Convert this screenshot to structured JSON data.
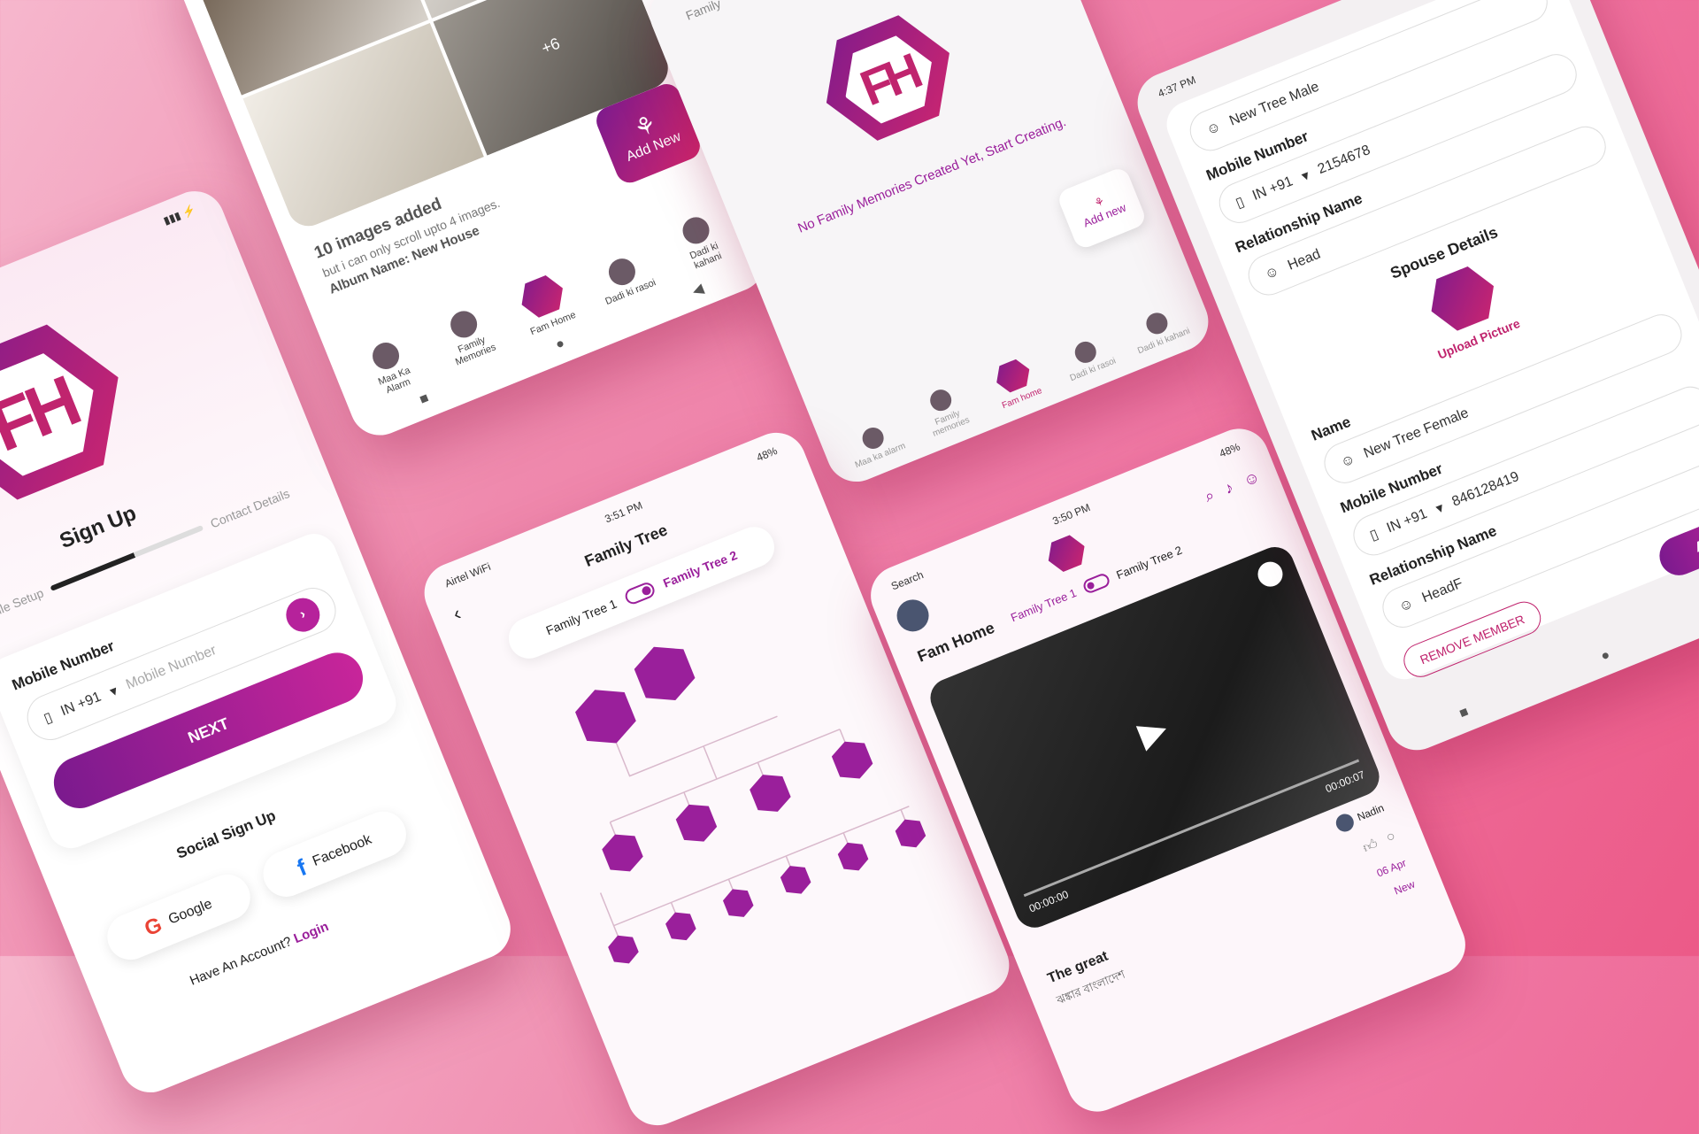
{
  "signup": {
    "title": "Sign Up",
    "steps": [
      "Profile Setup",
      "Contact Details"
    ],
    "mobile_label": "Mobile Number",
    "country_code": "IN +91",
    "mobile_placeholder": "Mobile Number",
    "next_label": "NEXT",
    "social_title": "Social Sign Up",
    "facebook_label": "Facebook",
    "google_label": "Google",
    "have_account": "Have An Account?",
    "login_label": "Login"
  },
  "album": {
    "more_count": "+6",
    "images_added": "10 images added",
    "scroll_note": "but i can only scroll upto 4 images.",
    "album_name": "Album Name: New House",
    "add_new_label": "Add New",
    "nav": [
      "Maa Ka Alarm",
      "Family Memories",
      "Fam Home",
      "Dadi ki rasoi",
      "Dadi ki kahani"
    ]
  },
  "memories": {
    "header": "Family",
    "empty_text": "No Family Memories Created Yet, Start Creating.",
    "add_new_label": "Add new",
    "nav": [
      "Maa ka alarm",
      "Family memories",
      "Fam home",
      "Dadi ki rasoi",
      "Dadi ki kahani"
    ]
  },
  "tree": {
    "time": "3:51 PM",
    "carrier": "Airtel WiFi",
    "battery": "48%",
    "title": "Family Tree",
    "toggle_left": "Family Tree 1",
    "toggle_right": "Family Tree 2"
  },
  "famhome": {
    "time": "3:50 PM",
    "carrier": "Search",
    "battery": "48%",
    "title": "Fam Home",
    "toggle_left": "Family Tree 1",
    "toggle_right": "Family Tree 2",
    "video_start": "00:00:00",
    "video_end": "00:00:07",
    "poster": "Nadin",
    "post_title": "The great",
    "post_sub": "ঝঙ্কার বাংলাদেশ",
    "post_date": "06 Apr",
    "new_label": "New"
  },
  "member": {
    "time": "4:37 PM",
    "top_name": "New Tree Male",
    "mobile_label": "Mobile Number",
    "country_code": "IN +91",
    "mobile_value": "2154678",
    "relationship_label": "Relationship Name",
    "relationship_value": "Head",
    "spouse_title": "Spouse Details",
    "upload_label": "Upload Picture",
    "name_label": "Name",
    "spouse_name": "New Tree Female",
    "spouse_mobile_label": "Mobile Number",
    "spouse_country_code": "IN +91",
    "spouse_mobile_value": "846128419",
    "spouse_relationship_label": "Relationship Name",
    "spouse_relationship_value": "HeadF",
    "remove_label": "REMOVE MEMBER",
    "add_label": "ADD"
  }
}
